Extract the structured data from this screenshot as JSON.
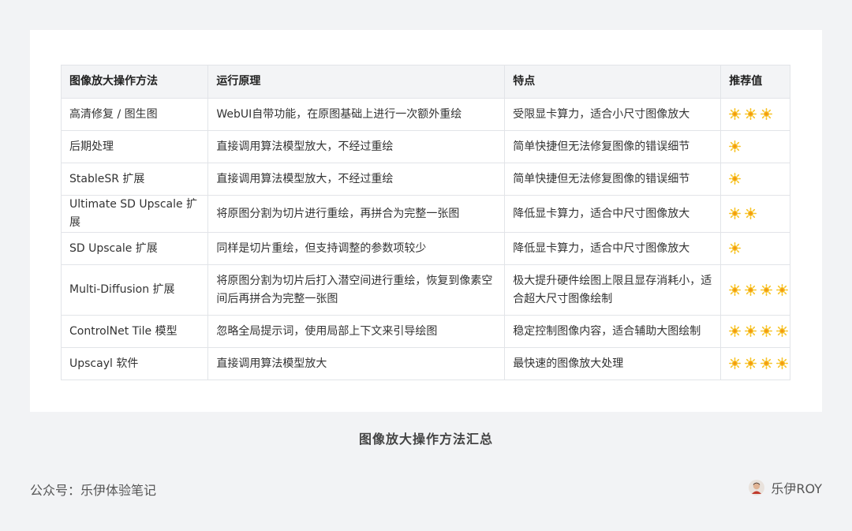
{
  "table": {
    "headers": [
      "图像放大操作方法",
      "运行原理",
      "特点",
      "推荐值"
    ],
    "rows": [
      {
        "method": "高清修复 / 图生图",
        "principle": "WebUI自带功能，在原图基础上进行一次额外重绘",
        "feature": "受限显卡算力，适合小尺寸图像放大",
        "rating": 3
      },
      {
        "method": "后期处理",
        "principle": "直接调用算法模型放大，不经过重绘",
        "feature": "简单快捷但无法修复图像的错误细节",
        "rating": 1
      },
      {
        "method": "StableSR 扩展",
        "principle": "直接调用算法模型放大，不经过重绘",
        "feature": "简单快捷但无法修复图像的错误细节",
        "rating": 1
      },
      {
        "method": "Ultimate SD Upscale 扩展",
        "principle": "将原图分割为切片进行重绘，再拼合为完整一张图",
        "feature": "降低显卡算力，适合中尺寸图像放大",
        "rating": 2
      },
      {
        "method": "SD Upscale 扩展",
        "principle": "同样是切片重绘，但支持调整的参数项较少",
        "feature": "降低显卡算力，适合中尺寸图像放大",
        "rating": 1
      },
      {
        "method": "Multi-Diffusion 扩展",
        "principle": "将原图分割为切片后打入潜空间进行重绘，恢复到像素空间后再拼合为完整一张图",
        "feature": "极大提升硬件绘图上限且显存消耗小，适合超大尺寸图像绘制",
        "rating": 4
      },
      {
        "method": "ControlNet Tile 模型",
        "principle": "忽略全局提示词，使用局部上下文来引导绘图",
        "feature": "稳定控制图像内容，适合辅助大图绘制",
        "rating": 4
      },
      {
        "method": "Upscayl 软件",
        "principle": "直接调用算法模型放大",
        "feature": "最快速的图像放大处理",
        "rating": 4
      }
    ]
  },
  "rating_icon": "sun-icon",
  "colors": {
    "sun_outer": "#f7c326",
    "sun_inner": "#f39a12",
    "background": "#f2f3f5",
    "card": "#ffffff",
    "header_bg": "#f3f4f6"
  },
  "caption": "图像放大操作方法汇总",
  "footer": {
    "left": "公众号：乐伊体验笔记",
    "right": "乐伊ROY"
  }
}
